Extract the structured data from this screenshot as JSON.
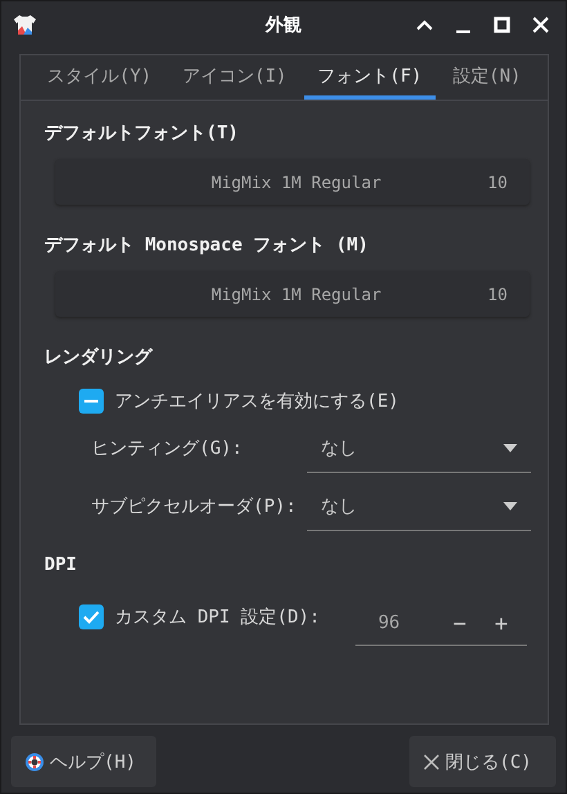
{
  "window": {
    "title": "外観"
  },
  "tabs": [
    {
      "label": "スタイル(Y)",
      "selected": false
    },
    {
      "label": "アイコン(I)",
      "selected": false
    },
    {
      "label": "フォント(F)",
      "selected": true
    },
    {
      "label": "設定(N)",
      "selected": false
    }
  ],
  "fonts": [
    {
      "heading": "デフォルトフォント(T)",
      "font": "MigMix 1M Regular",
      "size": "10"
    },
    {
      "heading": "デフォルト Monospace フォント (M)",
      "font": "MigMix 1M Regular",
      "size": "10"
    }
  ],
  "rendering": {
    "heading": "レンダリング",
    "antialias": {
      "label": "アンチエイリアスを有効にする(E)",
      "checked": true,
      "indeterminate": true
    },
    "combos": [
      {
        "label": "ヒンティング(G):",
        "value": "なし"
      },
      {
        "label": "サブピクセルオーダ(P):",
        "value": "なし"
      }
    ]
  },
  "dpi": {
    "heading": "DPI",
    "custom": {
      "label": "カスタム DPI 設定(D):",
      "checked": true
    },
    "value": "96",
    "minus": "−",
    "plus": "+"
  },
  "buttons": [
    {
      "kind": "help",
      "label": "ヘルプ(H)"
    },
    {
      "kind": "close",
      "label": "閉じる(C)"
    }
  ]
}
